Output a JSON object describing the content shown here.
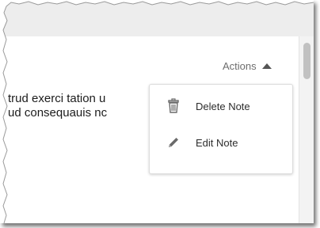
{
  "actions": {
    "label": "Actions"
  },
  "note": {
    "lines": [
      "trud exerci tation u",
      "ud consequauis nc"
    ]
  },
  "menu": {
    "items": [
      {
        "label": "Delete Note",
        "icon": "trash-icon"
      },
      {
        "label": "Edit Note",
        "icon": "pencil-icon"
      }
    ]
  },
  "colors": {
    "header_bar": "#ededed",
    "menu_text": "#2c2c2c",
    "muted_text": "#6d6d6d",
    "scroll_thumb": "#c1c1c1"
  }
}
